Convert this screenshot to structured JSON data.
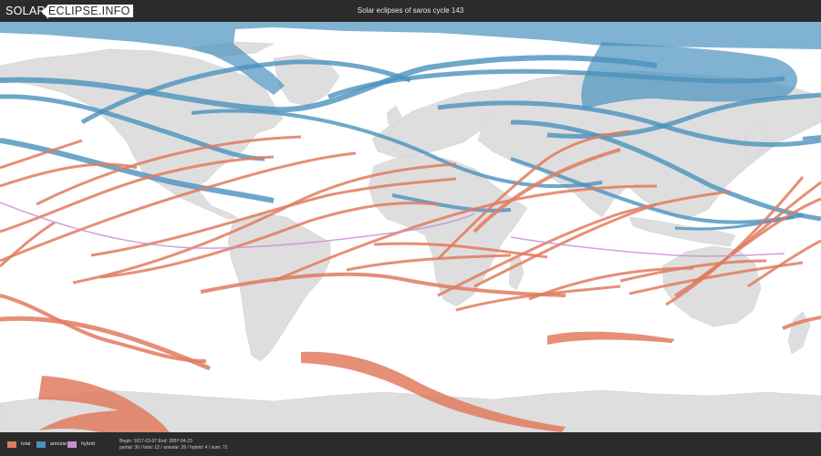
{
  "header": {
    "logo_part1": "SOLAR",
    "logo_part2": "ECLIPSE.INFO",
    "title": "Solar eclipses of saros cycle 143"
  },
  "colors": {
    "total": "#e07b5f",
    "annular": "#4a91bd",
    "hybrid": "#c98fd0",
    "land": "#dedede",
    "ocean": "#ffffff",
    "bar": "#2b2b2b"
  },
  "legend": [
    {
      "key": "total",
      "label": "total",
      "color": "#e07b5f"
    },
    {
      "key": "annular",
      "label": "annular",
      "color": "#4a91bd"
    },
    {
      "key": "hybrid",
      "label": "hybrid",
      "color": "#c98fd0"
    }
  ],
  "info": {
    "line1": "Begin: 1617-03-07  End: 2897-04-23",
    "line2": "partial: 30 / total: 12 / annular: 26 / hybrid: 4 / sum: 72"
  }
}
